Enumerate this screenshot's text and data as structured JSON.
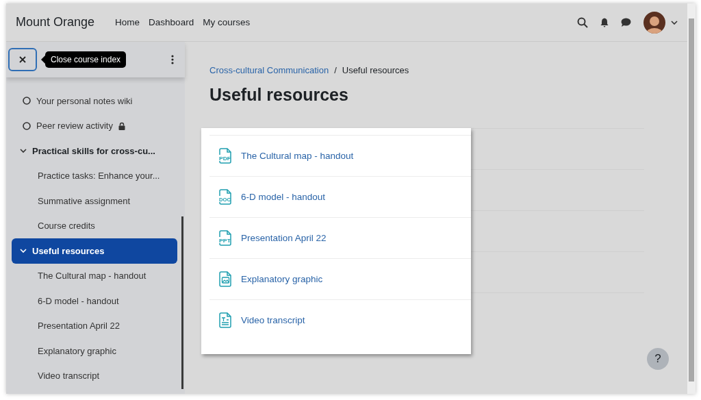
{
  "navbar": {
    "brand": "Mount Orange",
    "links": [
      {
        "label": "Home"
      },
      {
        "label": "Dashboard"
      },
      {
        "label": "My courses"
      }
    ]
  },
  "course_index": {
    "close_tooltip": "Close course index",
    "items": [
      {
        "kind": "activity",
        "label": "Your personal notes wiki",
        "locked": false
      },
      {
        "kind": "activity",
        "label": "Peer review activity",
        "locked": true
      },
      {
        "kind": "section",
        "label": "Practical skills for cross-cu...",
        "expanded": true,
        "selected": false,
        "children": [
          {
            "label": "Practice tasks: Enhance your..."
          },
          {
            "label": "Summative assignment"
          },
          {
            "label": "Course credits"
          }
        ]
      },
      {
        "kind": "section",
        "label": "Useful resources",
        "expanded": true,
        "selected": true,
        "children": [
          {
            "label": "The Cultural map - handout"
          },
          {
            "label": "6-D model - handout"
          },
          {
            "label": "Presentation April 22"
          },
          {
            "label": "Explanatory graphic"
          },
          {
            "label": "Video transcript"
          }
        ]
      }
    ]
  },
  "breadcrumb": [
    {
      "label": "Cross-cultural Communication",
      "link": true
    },
    {
      "label": "Useful resources",
      "link": false
    }
  ],
  "breadcrumb_separator": "/",
  "page_title": "Useful resources",
  "resources": [
    {
      "kind": "file",
      "badge": "PDF",
      "label": "The Cultural map - handout"
    },
    {
      "kind": "file",
      "badge": "DOC",
      "label": "6-D model - handout"
    },
    {
      "kind": "file",
      "badge": "PPT",
      "label": "Presentation April 22"
    },
    {
      "kind": "image",
      "label": "Explanatory graphic"
    },
    {
      "kind": "text",
      "label": "Video transcript"
    }
  ],
  "help_button": "?"
}
